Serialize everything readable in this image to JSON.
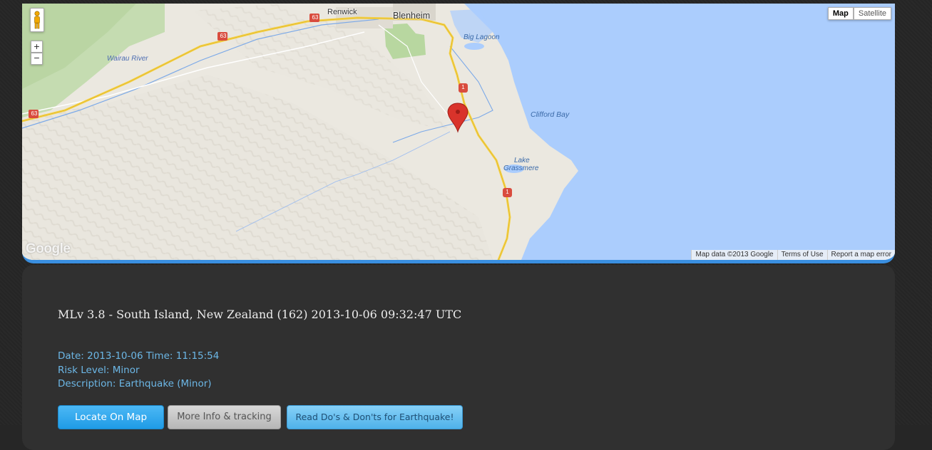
{
  "map": {
    "type_buttons": [
      "Map",
      "Satellite"
    ],
    "active_type": "Map",
    "zoom_in": "+",
    "zoom_out": "−",
    "logo": "Google",
    "attribution": [
      "Map data ©2013 Google",
      "Terms of Use",
      "Report a map error"
    ],
    "labels": {
      "renwick": "Renwick",
      "blenheim": "Blenheim",
      "big_lagoon": "Big Lagoon",
      "wairau_river": "Wairau River",
      "clifford_bay": "Clifford Bay",
      "lake_grassmere_1": "Lake",
      "lake_grassmere_2": "Grassmere",
      "route_63": "63",
      "route_1": "1"
    },
    "colors": {
      "sea": "#abcdfd",
      "land": "#e8e5dc",
      "road": "#f5d34b",
      "marker": "#d9332b"
    }
  },
  "event": {
    "title": "MLv 3.8 - South Island, New Zealand (162) 2013-10-06 09:32:47 UTC",
    "date_line": "Date: 2013-10-06 Time: 11:15:54",
    "risk_line": "Risk Level: Minor",
    "description_line": "Description: Earthquake (Minor)"
  },
  "buttons": {
    "locate": "Locate On Map",
    "more_info": "More Info & tracking",
    "read_dos": "Read Do's & Don'ts for Earthquake!"
  }
}
